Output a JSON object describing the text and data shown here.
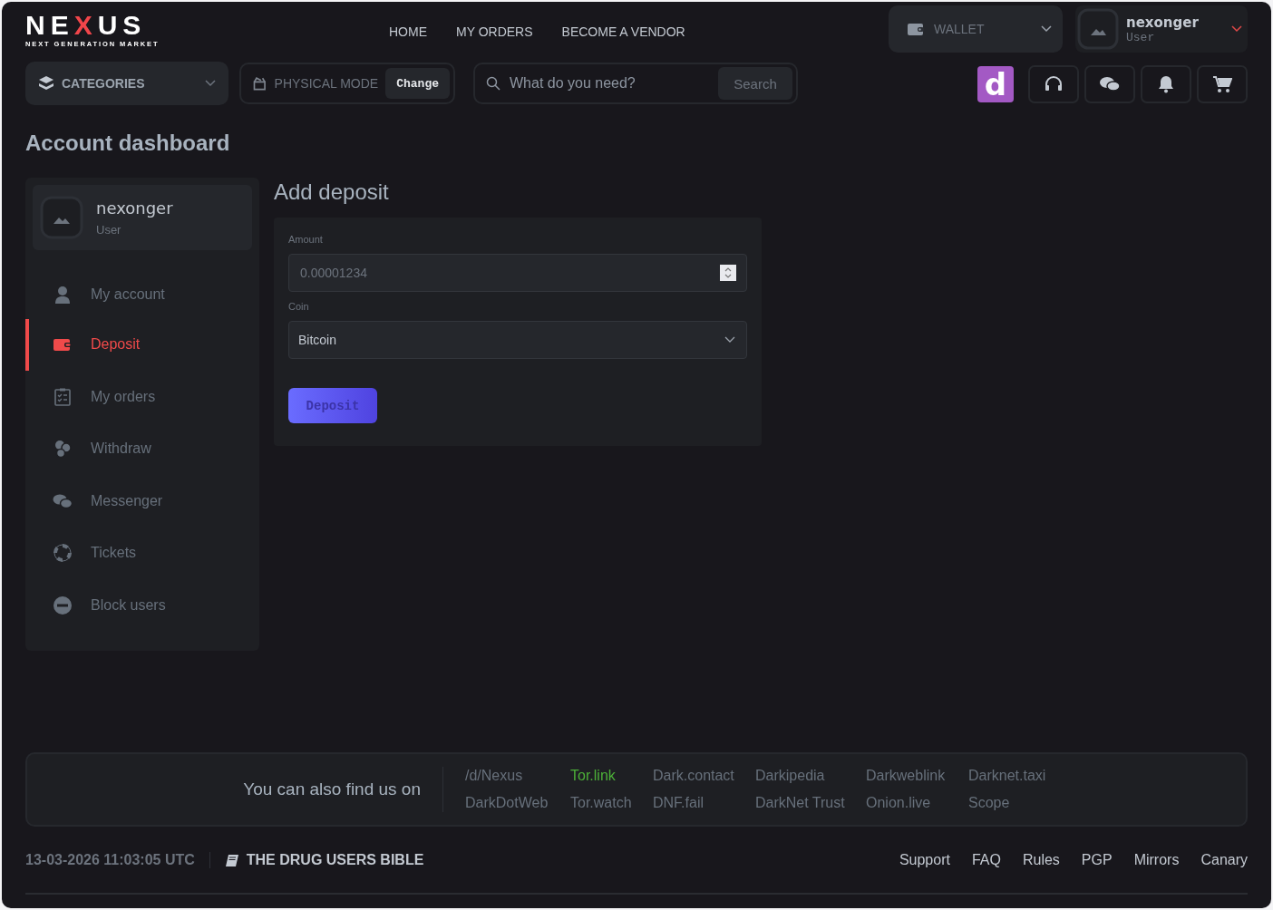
{
  "logo": {
    "parts": [
      {
        "text": "NE",
        "accent": false
      },
      {
        "text": "X",
        "accent": true
      },
      {
        "text": "US",
        "accent": false
      }
    ],
    "tagline": "NEXT GENERATION MARKET"
  },
  "nav": [
    "HOME",
    "MY ORDERS",
    "BECOME A VENDOR"
  ],
  "wallet": {
    "label": "WALLET"
  },
  "user_menu": {
    "name": "nexonger",
    "role": "User"
  },
  "categories": {
    "label": "CATEGORIES"
  },
  "mode": {
    "label": "PHYSICAL MODE",
    "button": "Change"
  },
  "search": {
    "placeholder": "What do you need?",
    "button": "Search"
  },
  "forum_badge": "d",
  "page_title": "Account dashboard",
  "profile": {
    "name": "nexonger",
    "role": "User"
  },
  "sidebar": {
    "items": [
      {
        "label": "My account",
        "selected": false
      },
      {
        "label": "Deposit",
        "selected": true
      },
      {
        "label": "My orders",
        "selected": false
      },
      {
        "label": "Withdraw",
        "selected": false
      },
      {
        "label": "Messenger",
        "selected": false
      },
      {
        "label": "Tickets",
        "selected": false
      },
      {
        "label": "Block users",
        "selected": false
      }
    ]
  },
  "deposit_form": {
    "title": "Add deposit",
    "amount": {
      "label": "Amount",
      "placeholder": "0.00001234"
    },
    "coin": {
      "label": "Coin",
      "value": "Bitcoin"
    },
    "submit": "Deposit"
  },
  "find_us": {
    "text": "You can also find us on",
    "links": [
      {
        "label": "/d/Nexus",
        "highlighted": false
      },
      {
        "label": "Tor.link",
        "highlighted": true
      },
      {
        "label": "Dark.contact",
        "highlighted": false
      },
      {
        "label": "Darkipedia",
        "highlighted": false
      },
      {
        "label": "Darkweblink",
        "highlighted": false
      },
      {
        "label": "Darknet.taxi",
        "highlighted": false
      },
      {
        "label": "DarkDotWeb",
        "highlighted": false
      },
      {
        "label": "Tor.watch",
        "highlighted": false
      },
      {
        "label": "DNF.fail",
        "highlighted": false
      },
      {
        "label": "DarkNet Trust",
        "highlighted": false
      },
      {
        "label": "Onion.live",
        "highlighted": false
      },
      {
        "label": "Scope",
        "highlighted": false
      }
    ]
  },
  "footer": {
    "timestamp": "13-03-2026 11:03:05 UTC",
    "guide_link": "THE DRUG USERS BIBLE",
    "links": [
      "Support",
      "FAQ",
      "Rules",
      "PGP",
      "Mirrors",
      "Canary"
    ]
  }
}
